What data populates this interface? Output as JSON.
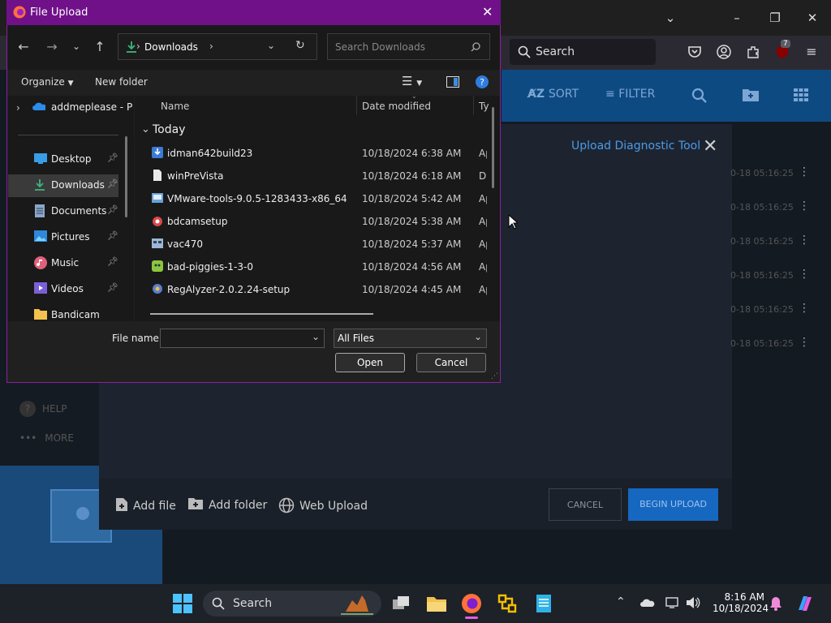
{
  "browser": {
    "search_label": "Search",
    "extension_badge": "7"
  },
  "webapp": {
    "header": {
      "sort": "SORT",
      "filter": "FILTER"
    },
    "sidebar": {
      "help": "HELP",
      "more": "MORE"
    },
    "upload_dialog": {
      "title": "Upload Diagnostic Tool",
      "add_file": "Add file",
      "add_folder": "Add folder",
      "web_upload": "Web Upload",
      "cancel": "CANCEL",
      "begin": "BEGIN UPLOAD"
    },
    "row_dates": [
      "0-18 05:16:25",
      "0-18 05:16:25",
      "0-18 05:16:25",
      "0-18 05:16:25",
      "0-18 05:16:25",
      "0-18 05:16:25"
    ]
  },
  "file_dialog": {
    "title": "File Upload",
    "address": "Downloads",
    "search_placeholder": "Search Downloads",
    "organize": "Organize",
    "new_folder": "New folder",
    "nav": [
      {
        "label": "addmeplease - P",
        "icon": "onedrive-icon",
        "pinned": false
      },
      {
        "label": "Desktop",
        "icon": "desktop-icon",
        "pinned": true
      },
      {
        "label": "Downloads",
        "icon": "downloads-icon",
        "pinned": true
      },
      {
        "label": "Documents",
        "icon": "documents-icon",
        "pinned": true
      },
      {
        "label": "Pictures",
        "icon": "pictures-icon",
        "pinned": true
      },
      {
        "label": "Music",
        "icon": "music-icon",
        "pinned": true
      },
      {
        "label": "Videos",
        "icon": "videos-icon",
        "pinned": true
      },
      {
        "label": "Bandicam",
        "icon": "folder-icon",
        "pinned": false
      }
    ],
    "columns": {
      "name": "Name",
      "date": "Date modified",
      "type": "Ty"
    },
    "group": "Today",
    "files": [
      {
        "name": "idman642build23",
        "date": "10/18/2024 6:38 AM",
        "type": "Ap",
        "color": "#3a7bd5"
      },
      {
        "name": "winPreVista",
        "date": "10/18/2024 6:18 AM",
        "type": "Di",
        "color": "#e8e8e8"
      },
      {
        "name": "VMware-tools-9.0.5-1283433-x86_64",
        "date": "10/18/2024 5:42 AM",
        "type": "Ap",
        "color": "#6aa2d8"
      },
      {
        "name": "bdcamsetup",
        "date": "10/18/2024 5:38 AM",
        "type": "Ap",
        "color": "#d94848"
      },
      {
        "name": "vac470",
        "date": "10/18/2024 5:37 AM",
        "type": "Ap",
        "color": "#9bb6d6"
      },
      {
        "name": "bad-piggies-1-3-0",
        "date": "10/18/2024 4:56 AM",
        "type": "Ap",
        "color": "#8cc63f"
      },
      {
        "name": "RegAlyzer-2.0.2.24-setup",
        "date": "10/18/2024 4:45 AM",
        "type": "Ap",
        "color": "#5a7fd0"
      }
    ],
    "file_name_label": "File name:",
    "file_name_value": "",
    "file_type": "All Files",
    "open": "Open",
    "cancel": "Cancel"
  },
  "taskbar": {
    "search": "Search",
    "time": "8:16 AM",
    "date": "10/18/2024"
  }
}
